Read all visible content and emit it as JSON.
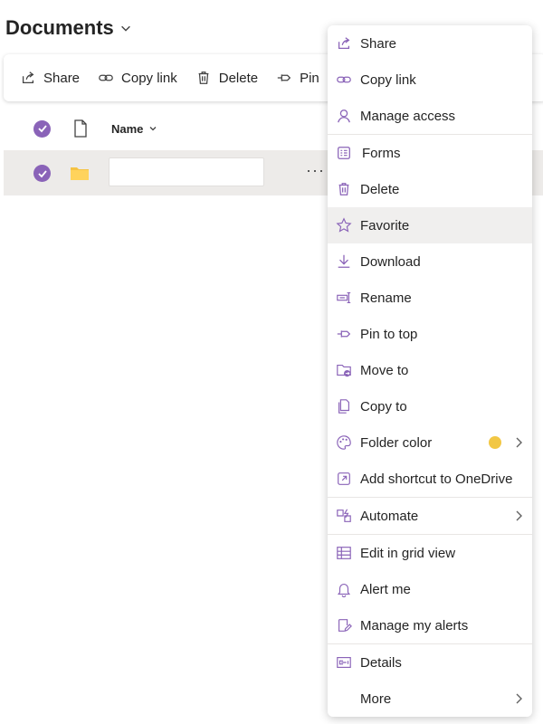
{
  "page": {
    "title": "Documents"
  },
  "toolbar": {
    "share": "Share",
    "copy_link": "Copy link",
    "delete": "Delete",
    "pin": "Pin"
  },
  "list": {
    "name_header": "Name"
  },
  "menu": {
    "items": [
      {
        "label": "Share"
      },
      {
        "label": "Copy link"
      },
      {
        "label": "Manage access"
      },
      {
        "label": "Forms"
      },
      {
        "label": "Delete"
      },
      {
        "label": "Favorite"
      },
      {
        "label": "Download"
      },
      {
        "label": "Rename"
      },
      {
        "label": "Pin to top"
      },
      {
        "label": "Move to"
      },
      {
        "label": "Copy to"
      },
      {
        "label": "Folder color"
      },
      {
        "label": "Add shortcut to OneDrive"
      },
      {
        "label": "Automate"
      },
      {
        "label": "Edit in grid view"
      },
      {
        "label": "Alert me"
      },
      {
        "label": "Manage my alerts"
      },
      {
        "label": "Details"
      },
      {
        "label": "More"
      }
    ]
  },
  "colors": {
    "accent": "#8a63b8",
    "folder": "#f5c343",
    "folder_color_dot": "#f2c744"
  }
}
